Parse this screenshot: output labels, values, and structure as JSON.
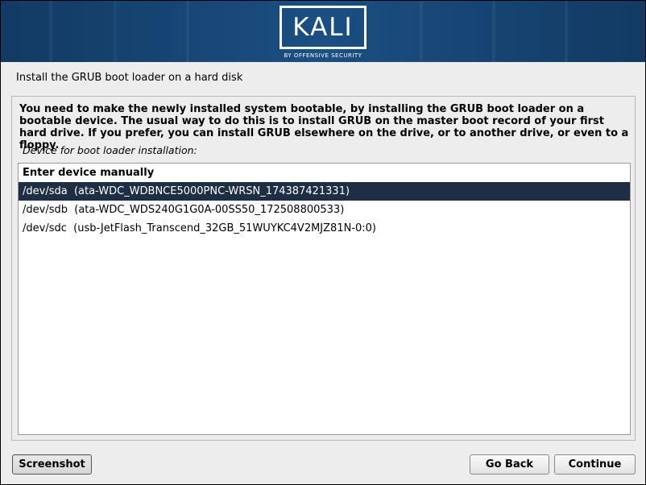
{
  "banner": {
    "logo_text": "KALI",
    "logo_subtitle": "BY OFFENSIVE SECURITY",
    "background_color": "#1b4f82"
  },
  "page_title": "Install the GRUB boot loader on a hard disk",
  "description": "You need to make the newly installed system bootable, by installing the GRUB boot loader on a bootable device. The usual way to do this is to install GRUB on the master boot record of your first hard drive. If you prefer, you can install GRUB elsewhere on the drive, or to another drive, or even to a floppy.",
  "list_label": "Device for boot loader installation:",
  "devices": [
    {
      "label": "Enter device manually",
      "selected": false
    },
    {
      "label": "/dev/sda  (ata-WDC_WDBNCE5000PNC-WRSN_174387421331)",
      "selected": true
    },
    {
      "label": "/dev/sdb  (ata-WDC_WDS240G1G0A-00SS50_172508800533)",
      "selected": false
    },
    {
      "label": "/dev/sdc  (usb-JetFlash_Transcend_32GB_51WUYKC4V2MJZ81N-0:0)",
      "selected": false
    }
  ],
  "selection_color": "#1e2e45",
  "buttons": {
    "screenshot": "Screenshot",
    "back": "Go Back",
    "continue": "Continue"
  }
}
